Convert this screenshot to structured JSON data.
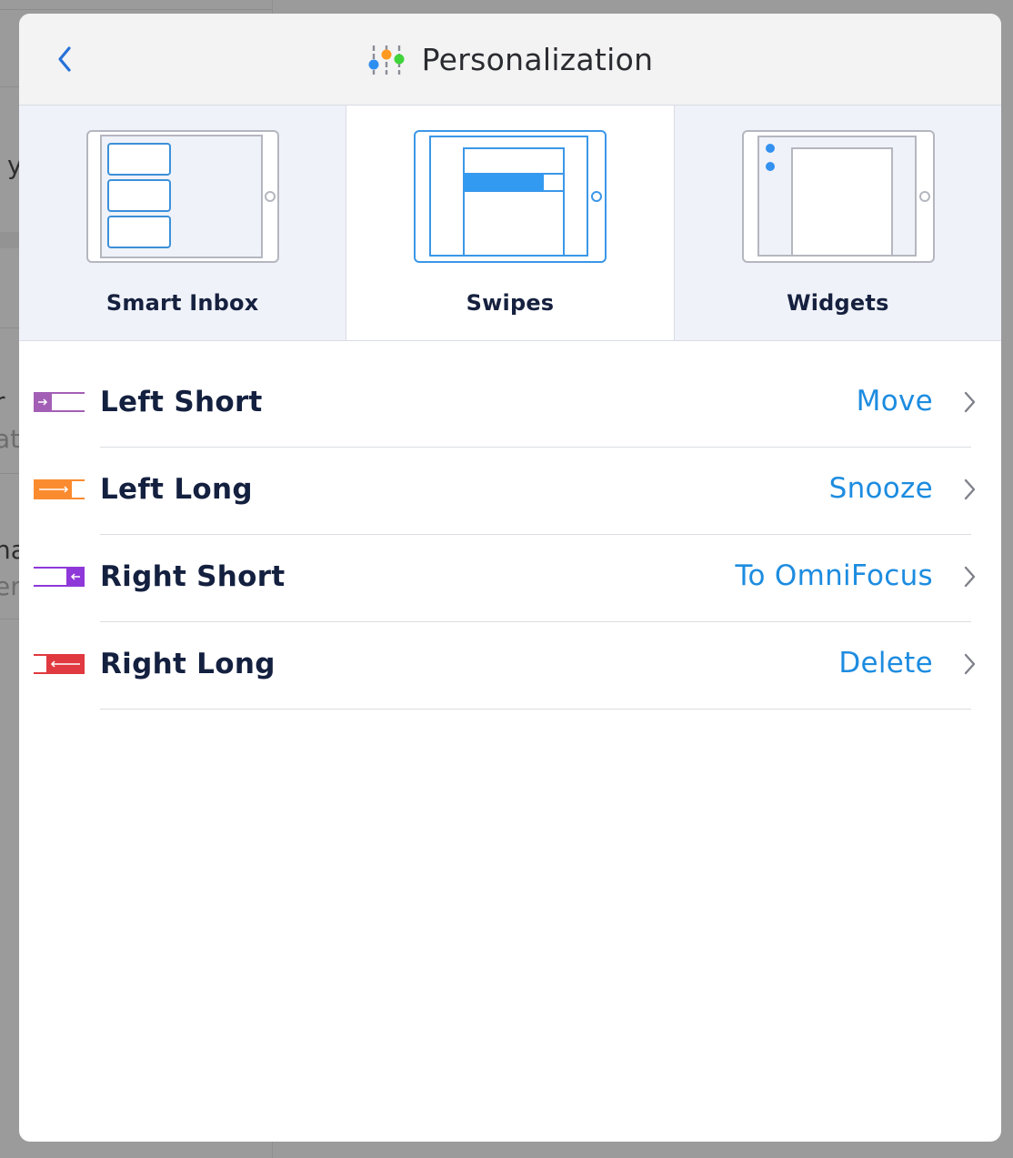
{
  "background_app": {
    "fragments": [
      "y",
      "r",
      "at",
      "na",
      "er"
    ]
  },
  "header": {
    "title": "Personalization",
    "back_icon": "chevron-left-icon",
    "title_icon": "sliders-icon"
  },
  "tabs": [
    {
      "label": "Smart Inbox",
      "icon": "smart-inbox-device-icon",
      "active": false
    },
    {
      "label": "Swipes",
      "icon": "swipes-device-icon",
      "active": true
    },
    {
      "label": "Widgets",
      "icon": "widgets-device-icon",
      "active": false
    }
  ],
  "swipes": [
    {
      "label": "Left Short",
      "action": "Move",
      "icon": "swipe-left-short-icon",
      "color": "#a35fb5"
    },
    {
      "label": "Left Long",
      "action": "Snooze",
      "icon": "swipe-left-long-icon",
      "color": "#fb8b2f"
    },
    {
      "label": "Right Short",
      "action": "To OmniFocus",
      "icon": "swipe-right-short-icon",
      "color": "#8f38d9"
    },
    {
      "label": "Right Long",
      "action": "Delete",
      "icon": "swipe-right-long-icon",
      "color": "#e0393f"
    }
  ],
  "colors": {
    "accent": "#1d8ce0",
    "back_arrow": "#2771d8",
    "tab_inactive_bg": "#eff2f9",
    "tab_active_bg": "#ffffff"
  }
}
